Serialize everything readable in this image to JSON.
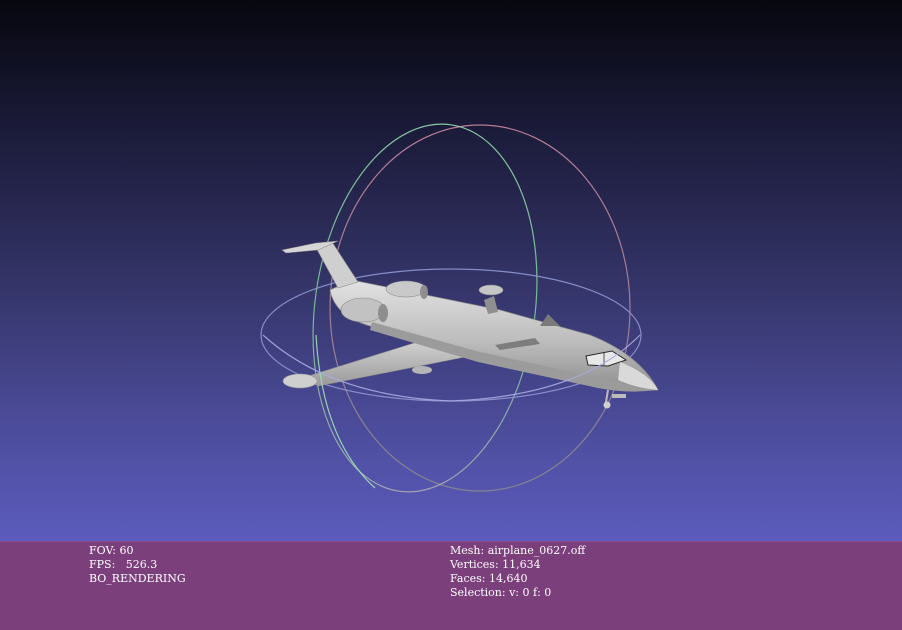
{
  "window": {
    "title": ""
  },
  "viewport": {
    "background_top": "#07070f",
    "background_bottom": "#6767d6",
    "trackball": {
      "ring_colors": [
        "#7d8ee0",
        "#b28ab8",
        "#9be0b0"
      ],
      "ring_gradients": [
        "#c07090",
        "#70d0a0"
      ]
    },
    "model_color": "#c8c8c8"
  },
  "info": {
    "fov": "FOV: 60",
    "fps": "FPS:   526.3",
    "rendering": "BO_RENDERING",
    "mesh": "Mesh: airplane_0627.off",
    "vertices": "Vertices: 11,634",
    "faces": "Faces: 14,640",
    "selection": "Selection: v: 0 f: 0"
  },
  "panel_color": "#7b3f7b"
}
